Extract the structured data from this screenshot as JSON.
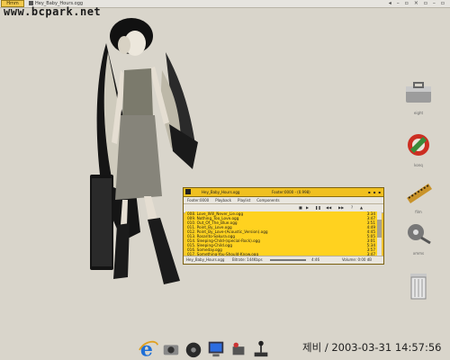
{
  "taskbar": {
    "start_label": "Hmm",
    "task_title": "Hey_Baby_Hours.ogg",
    "tray_icons": [
      "speaker-icon",
      "minus-icon",
      "square-icon",
      "close-icon",
      "square-icon",
      "minus-icon",
      "square-icon"
    ]
  },
  "watermark": "www.bcpark.net",
  "desktop_icons": [
    {
      "name": "briefcase-icon",
      "label": "eight"
    },
    {
      "name": "browser-icon",
      "label": "konq"
    },
    {
      "name": "film-icon",
      "label": "film"
    },
    {
      "name": "film-reel-icon",
      "label": "xmms"
    },
    {
      "name": "trash-icon",
      "label": ""
    }
  ],
  "player": {
    "title_track": "Hey_Baby_Hours.ogg",
    "title_app": "Footer:0000 - (0.998)",
    "menu": [
      "Footer:0000",
      "Playback",
      "Playlist",
      "Components"
    ],
    "playlist": [
      {
        "n": "008. Love_Will_Never_Lie.ogg",
        "d": "3:34"
      },
      {
        "n": "009. Nothing_Too_Love.ogg",
        "d": "3:47"
      },
      {
        "n": "010. Out_Of_The_Blue.ogg",
        "d": "3:51"
      },
      {
        "n": "011. Point_By_Love.ogg",
        "d": "4:49"
      },
      {
        "n": "012. Point_By_Love-(Acoustic_Version).ogg",
        "d": "4:45"
      },
      {
        "n": "013. Rosarito-Sakura.ogg",
        "d": "5:05"
      },
      {
        "n": "014. Sleeping-Child-(special-Rock).ogg",
        "d": "3:01"
      },
      {
        "n": "015. Sleeping-Child.ogg",
        "d": "5:34"
      },
      {
        "n": "016. Someday.ogg",
        "d": "3:57"
      },
      {
        "n": "017. Something-You-Should-Know.ogg",
        "d": "3:47"
      }
    ],
    "status": {
      "left": "Hey_Baby_Hours.ogg",
      "info": "Bitrate: 144Kbps",
      "time": "4:46",
      "volume": "Volume: 0:00 dB"
    }
  },
  "dock_icons": [
    "browser-e-icon",
    "camera-icon",
    "cd-icon",
    "monitor-icon",
    "network-icon",
    "joystick-icon"
  ],
  "clock": "제비 / 2003-03-31 14:57:56",
  "colors": {
    "desktop": "#d9d5cb",
    "player_yellow": "#ffd21f"
  }
}
